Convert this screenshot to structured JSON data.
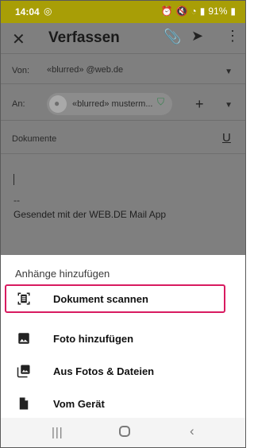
{
  "status_bar": {
    "time": "14:04",
    "battery": "91%"
  },
  "compose": {
    "title": "Verfassen",
    "from_label": "Von:",
    "from_value": "«blurred» @web.de",
    "to_label": "An:",
    "to_chip_name": "«blurred» musterm...",
    "subject_value": "Dokumente",
    "signature_dash": "--",
    "signature": "Gesendet mit der WEB.DE Mail App"
  },
  "sheet": {
    "title": "Anhänge hinzufügen",
    "options": [
      {
        "label": "Dokument scannen",
        "icon": "scan-document-icon"
      },
      {
        "label": "Foto hinzufügen",
        "icon": "image-icon"
      },
      {
        "label": "Aus Fotos & Dateien",
        "icon": "photo-library-icon"
      },
      {
        "label": "Vom Gerät",
        "icon": "file-icon"
      }
    ]
  },
  "colors": {
    "highlight": "#d81b60",
    "status_bar": "#a89e06",
    "overlay": "#7f7f7f"
  }
}
